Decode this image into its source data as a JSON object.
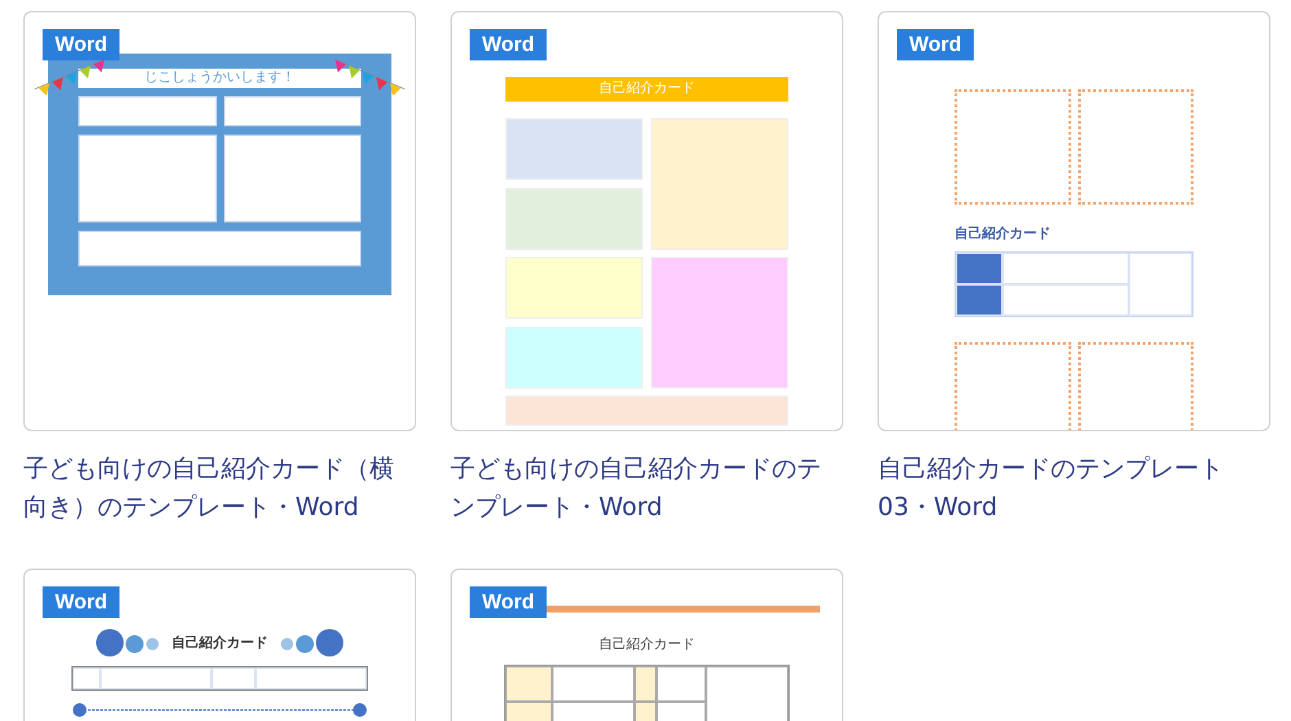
{
  "cards": [
    {
      "badge": "Word",
      "kind": "banner",
      "thumb_title": "じこしょうかいします！",
      "title": "子ども向けの自己紹介カード（横向き）のテンプレート・Word"
    },
    {
      "badge": "Word",
      "kind": "colorful",
      "thumb_title": "自己紹介カード",
      "title": "子ども向けの自己紹介カードのテンプレート・Word"
    },
    {
      "badge": "Word",
      "kind": "dotted",
      "thumb_title": "自己紹介カード",
      "title": "自己紹介カードのテンプレート03・Word"
    },
    {
      "badge": "Word",
      "kind": "circles",
      "thumb_title": "自己紹介カード"
    },
    {
      "badge": "Word",
      "kind": "lined",
      "thumb_title": "自己紹介カード"
    }
  ]
}
